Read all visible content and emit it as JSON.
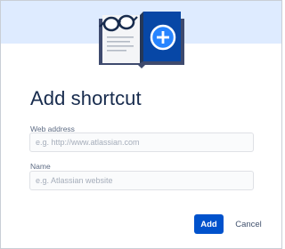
{
  "dialog": {
    "title": "Add shortcut",
    "illustration_icon": "book-with-glasses-plus-icon"
  },
  "form": {
    "web_address": {
      "label": "Web address",
      "value": "",
      "placeholder": "e.g. http://www.atlassian.com"
    },
    "name": {
      "label": "Name",
      "value": "",
      "placeholder": "e.g. Atlassian website"
    }
  },
  "actions": {
    "add_label": "Add",
    "cancel_label": "Cancel"
  },
  "colors": {
    "header_band": "#deebff",
    "primary_button": "#0052cc",
    "title_text": "#172b4d",
    "label_text": "#5e6c84",
    "placeholder_text": "#a5adba",
    "input_background": "#fafbfc",
    "input_border": "#dfe1e6"
  }
}
